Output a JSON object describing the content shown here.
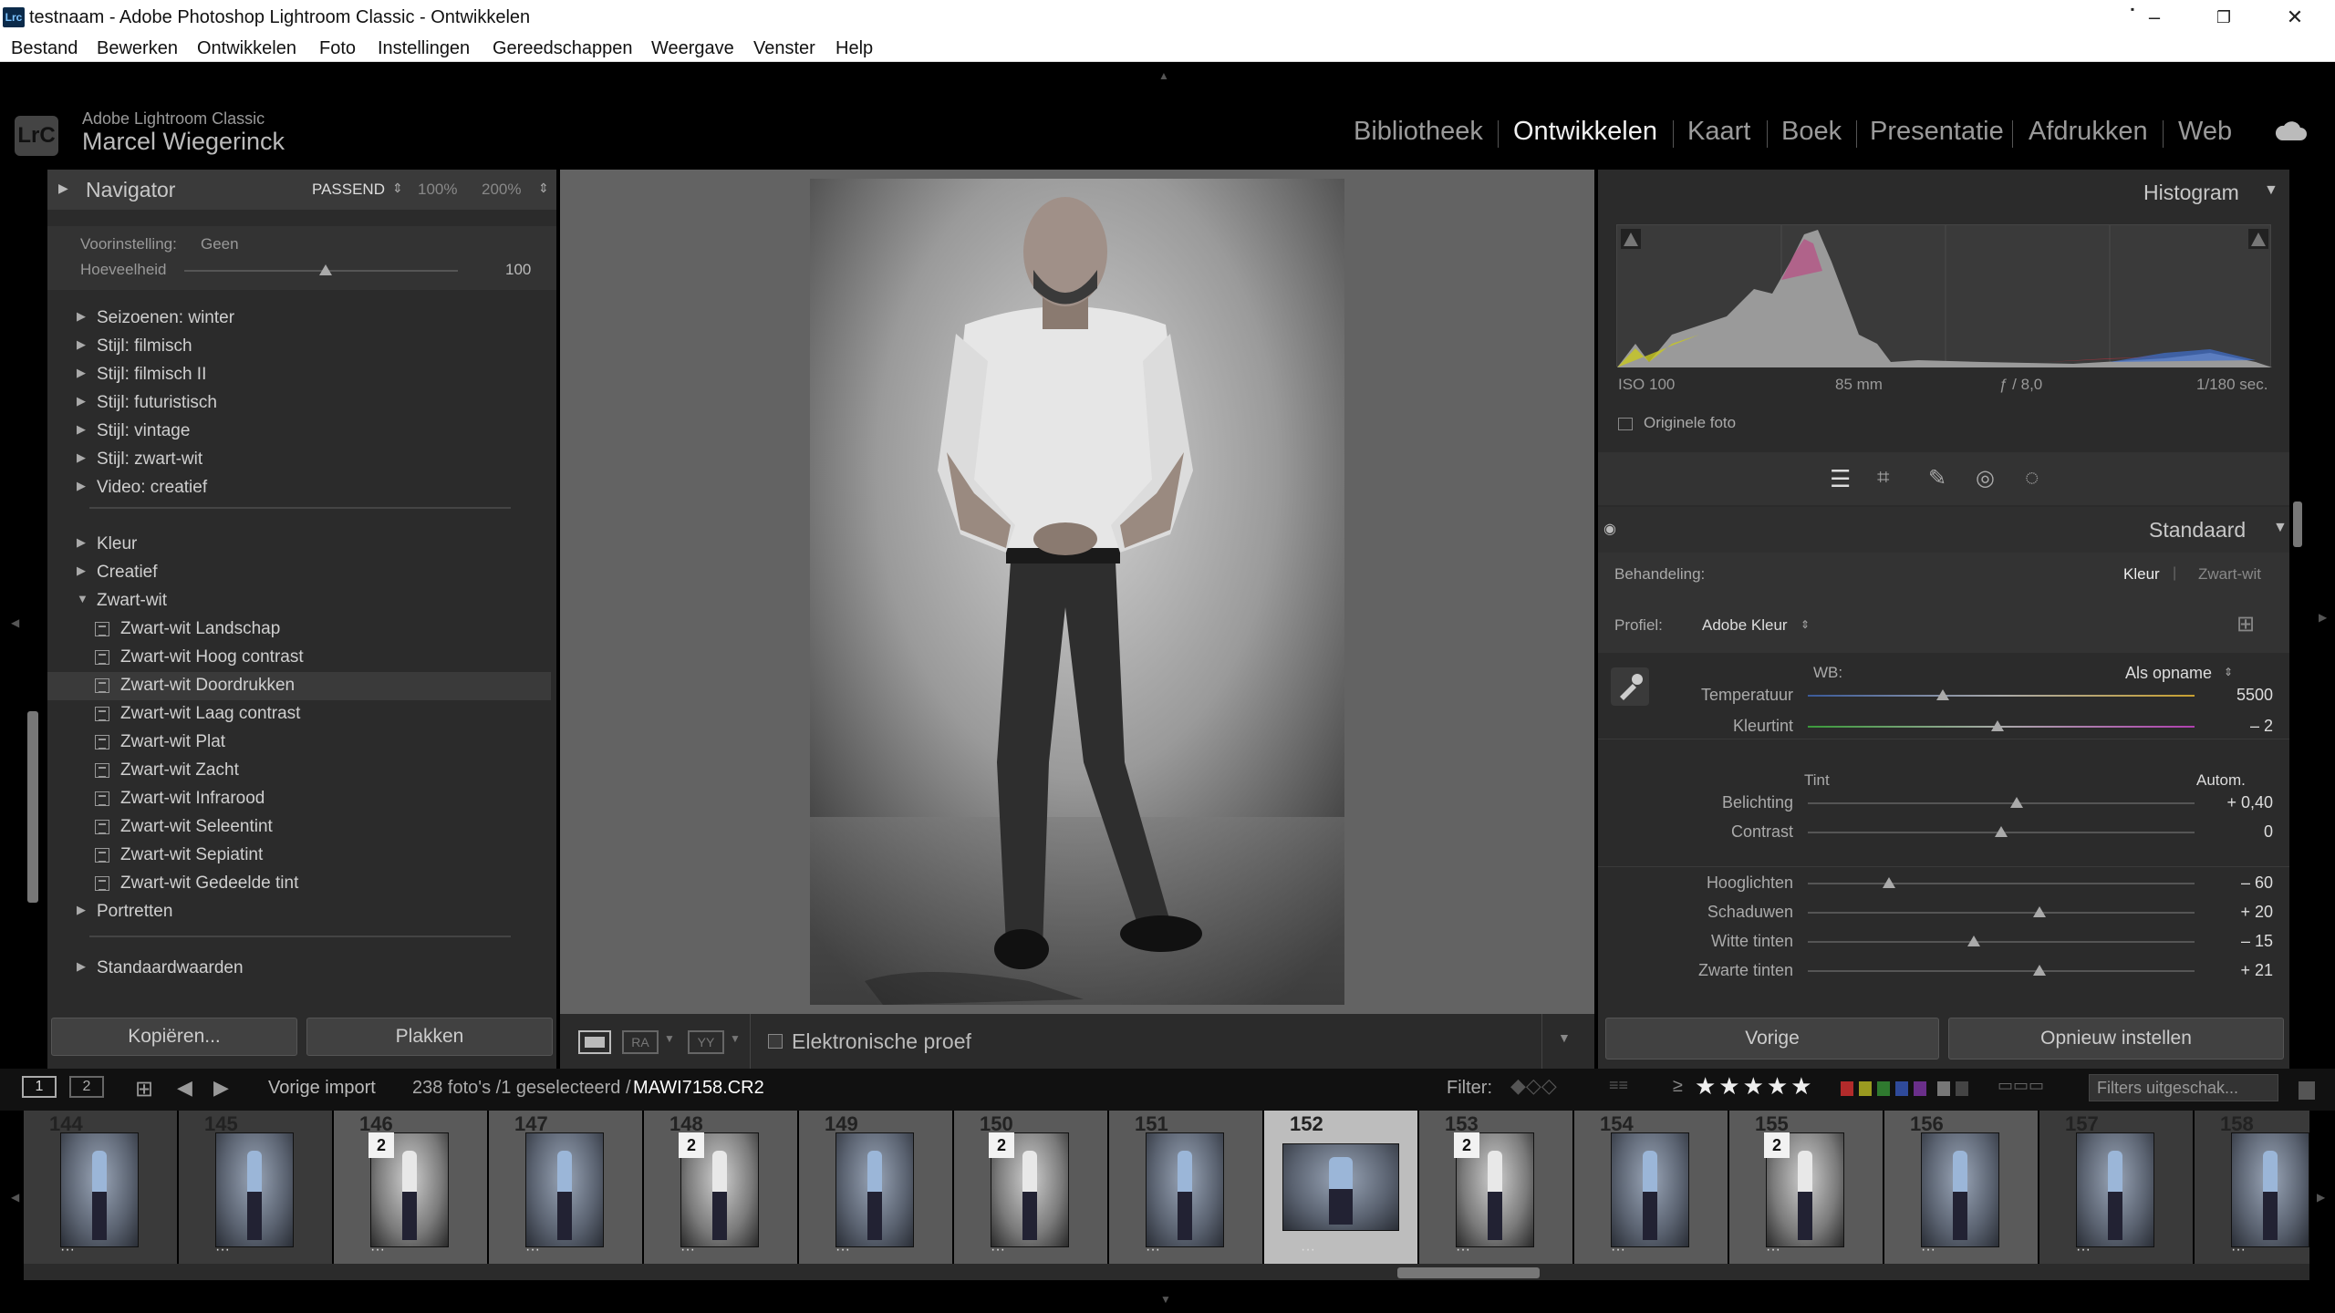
{
  "window": {
    "title": "testnaam - Adobe Photoshop Lightroom Classic - Ontwikkelen",
    "app_icon": "Lrc"
  },
  "menu": [
    "Bestand",
    "Bewerken",
    "Ontwikkelen",
    "Foto",
    "Instellingen",
    "Gereedschappen",
    "Weergave",
    "Venster",
    "Help"
  ],
  "identity": {
    "logo": "LrC",
    "product": "Adobe Lightroom Classic",
    "user": "Marcel Wiegerinck"
  },
  "modules": [
    "Bibliotheek",
    "Ontwikkelen",
    "Kaart",
    "Boek",
    "Presentatie",
    "Afdrukken",
    "Web"
  ],
  "active_module": "Ontwikkelen",
  "navigator": {
    "title": "Navigator",
    "zoom_fit": "PASSEND",
    "zoom_100": "100%",
    "zoom_200": "200%"
  },
  "presets_panel": {
    "voorinstelling_label": "Voorinstelling:",
    "voorinstelling_value": "Geen",
    "hoeveelheid_label": "Hoeveelheid",
    "hoeveelheid_value": "100",
    "hoeveelheid_fraction": 0.65,
    "groups_top": [
      "Seizoenen: winter",
      "Stijl: filmisch",
      "Stijl: filmisch II",
      "Stijl: futuristisch",
      "Stijl: vintage",
      "Stijl: zwart-wit",
      "Video: creatief"
    ],
    "groups_mid": [
      "Kleur",
      "Creatief"
    ],
    "open_group": "Zwart-wit",
    "open_items": [
      "Zwart-wit Landschap",
      "Zwart-wit Hoog contrast",
      "Zwart-wit Doordrukken",
      "Zwart-wit Laag contrast",
      "Zwart-wit Plat",
      "Zwart-wit Zacht",
      "Zwart-wit Infrarood",
      "Zwart-wit Seleentint",
      "Zwart-wit Sepiatint",
      "Zwart-wit Gedeelde tint"
    ],
    "highlighted_item": "Zwart-wit Doordrukken",
    "after_groups": [
      "Portretten"
    ],
    "last_group": "Standaardwaarden"
  },
  "left_buttons": {
    "copy": "Kopiëren...",
    "paste": "Plakken"
  },
  "toolbar": {
    "elektronische_proef": "Elektronische proef",
    "view_loupe": "loupe-view-icon",
    "view_ra": "RA",
    "view_yy": "YY"
  },
  "histogram": {
    "title": "Histogram",
    "iso": "ISO 100",
    "focal": "85 mm",
    "aperture": "ƒ / 8,0",
    "shutter": "1/180 sec.",
    "original_photo": "Originele foto"
  },
  "basic_panel": {
    "title": "Standaard",
    "behandeling_label": "Behandeling:",
    "kleur": "Kleur",
    "zwartwit": "Zwart-wit",
    "profiel_label": "Profiel:",
    "profiel_value": "Adobe Kleur",
    "wb_label": "WB:",
    "wb_value": "Als opname",
    "tint_label": "Tint",
    "autom": "Autom.",
    "sliders": [
      {
        "label": "Temperatuur",
        "value": "5500",
        "fraction": 0.35
      },
      {
        "label": "Kleurtint",
        "value": "– 2",
        "fraction": 0.49
      },
      {
        "label": "Belichting",
        "value": "+ 0,40",
        "fraction": 0.54
      },
      {
        "label": "Contrast",
        "value": "0",
        "fraction": 0.5
      },
      {
        "label": "Hooglichten",
        "value": "– 60",
        "fraction": 0.21
      },
      {
        "label": "Schaduwen",
        "value": "+ 20",
        "fraction": 0.6
      },
      {
        "label": "Witte tinten",
        "value": "– 15",
        "fraction": 0.43
      },
      {
        "label": "Zwarte tinten",
        "value": "+ 21",
        "fraction": 0.6
      }
    ]
  },
  "right_buttons": {
    "previous": "Vorige",
    "reset": "Opnieuw instellen"
  },
  "filmstrip_bar": {
    "screen1": "1",
    "screen2": "2",
    "source": "Vorige import",
    "count": "238 foto's /1 geselecteerd /",
    "filename": "MAWI7158.CR2",
    "filter_label": "Filter:",
    "filter_dropdown": "Filters uitgeschak...",
    "rating_op": "≥",
    "stars": 5
  },
  "filmstrip": [
    {
      "num": "144",
      "badge": "",
      "dim": true
    },
    {
      "num": "145",
      "badge": "",
      "dim": true
    },
    {
      "num": "146",
      "badge": "2",
      "dim": false
    },
    {
      "num": "147",
      "badge": "",
      "dim": false
    },
    {
      "num": "148",
      "badge": "2",
      "dim": false
    },
    {
      "num": "149",
      "badge": "",
      "dim": false
    },
    {
      "num": "150",
      "badge": "2",
      "dim": false
    },
    {
      "num": "151",
      "badge": "",
      "dim": false
    },
    {
      "num": "152",
      "badge": "",
      "dim": false,
      "selected": true
    },
    {
      "num": "153",
      "badge": "2",
      "dim": false
    },
    {
      "num": "154",
      "badge": "",
      "dim": false
    },
    {
      "num": "155",
      "badge": "2",
      "dim": false
    },
    {
      "num": "156",
      "badge": "",
      "dim": false
    },
    {
      "num": "157",
      "badge": "",
      "dim": true
    },
    {
      "num": "158",
      "badge": "",
      "dim": true
    }
  ],
  "colors": {
    "panel_bg": "#2b2b2b",
    "panel_header": "#3a3a3a",
    "active_text": "#f0f0f0",
    "label_red": "#b32b2b",
    "label_yellow": "#9a9a20",
    "label_green": "#2f7a2f",
    "label_blue": "#2f4a9a",
    "label_purple": "#6a2f8a"
  }
}
